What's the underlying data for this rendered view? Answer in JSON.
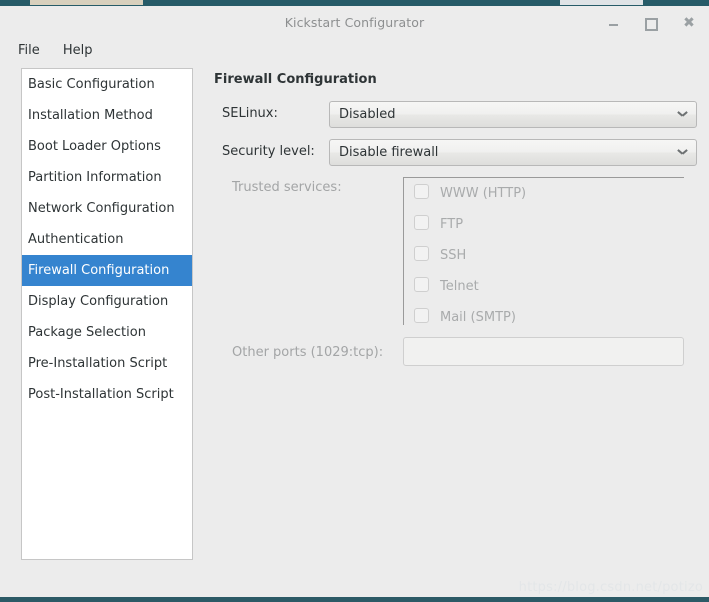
{
  "window": {
    "title": "Kickstart Configurator",
    "controls": {
      "minimize_label": "Minimize",
      "maximize_label": "Maximize",
      "close_label": "Close"
    }
  },
  "menubar": {
    "items": [
      {
        "label": "File"
      },
      {
        "label": "Help"
      }
    ]
  },
  "sidebar": {
    "items": [
      {
        "label": "Basic Configuration",
        "selected": false
      },
      {
        "label": "Installation Method",
        "selected": false
      },
      {
        "label": "Boot Loader Options",
        "selected": false
      },
      {
        "label": "Partition Information",
        "selected": false
      },
      {
        "label": "Network Configuration",
        "selected": false
      },
      {
        "label": "Authentication",
        "selected": false
      },
      {
        "label": "Firewall Configuration",
        "selected": true
      },
      {
        "label": "Display Configuration",
        "selected": false
      },
      {
        "label": "Package Selection",
        "selected": false
      },
      {
        "label": "Pre-Installation Script",
        "selected": false
      },
      {
        "label": "Post-Installation Script",
        "selected": false
      }
    ]
  },
  "panel": {
    "title": "Firewall Configuration",
    "selinux": {
      "label": "SELinux:",
      "value": "Disabled"
    },
    "security_level": {
      "label": "Security level:",
      "value": "Disable firewall"
    },
    "trusted_services": {
      "label": "Trusted services:",
      "items": [
        {
          "label": "WWW (HTTP)",
          "checked": false
        },
        {
          "label": "FTP",
          "checked": false
        },
        {
          "label": "SSH",
          "checked": false
        },
        {
          "label": "Telnet",
          "checked": false
        },
        {
          "label": "Mail (SMTP)",
          "checked": false
        }
      ]
    },
    "other_ports": {
      "label": "Other ports (1029:tcp):",
      "value": "",
      "placeholder": ""
    }
  },
  "watermark": {
    "text": "https://blog.csdn.net/potizo"
  },
  "colors": {
    "window_bg": "#ececec",
    "selection": "#3584cf",
    "selection_text": "#ffffff",
    "text": "#2e3436",
    "disabled_text": "#a3a5a6",
    "title_text": "#8d8f90",
    "desktop_strip": "#265b68",
    "list_bg": "#ffffff"
  }
}
